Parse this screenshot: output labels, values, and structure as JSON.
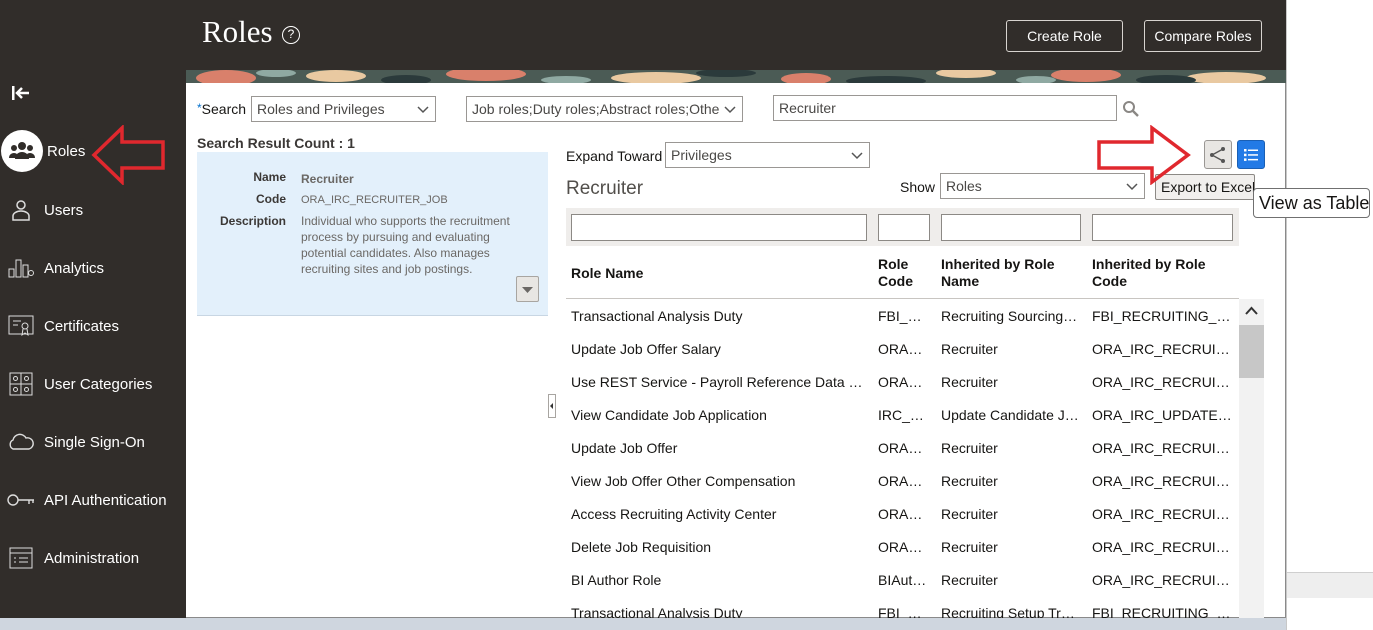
{
  "header": {
    "title": "Roles",
    "create_role": "Create Role",
    "compare_roles": "Compare Roles"
  },
  "sidebar": {
    "items": [
      {
        "label": "Roles",
        "icon": "roles-icon",
        "active": true
      },
      {
        "label": "Users",
        "icon": "user-icon"
      },
      {
        "label": "Analytics",
        "icon": "analytics-icon"
      },
      {
        "label": "Certificates",
        "icon": "certificate-icon"
      },
      {
        "label": "User Categories",
        "icon": "user-categories-icon"
      },
      {
        "label": "Single Sign-On",
        "icon": "cloud-icon"
      },
      {
        "label": "API Authentication",
        "icon": "key-icon"
      },
      {
        "label": "Administration",
        "icon": "administration-icon"
      }
    ]
  },
  "search": {
    "required_mark": "*",
    "label": "Search",
    "type_value": "Roles and Privileges",
    "role_types_value": "Job roles;Duty roles;Abstract roles;Othe",
    "query_value": "Recruiter"
  },
  "results": {
    "count_label": "Search Result Count : 1",
    "name_label": "Name",
    "name_value": "Recruiter",
    "code_label": "Code",
    "code_value": "ORA_IRC_RECRUITER_JOB",
    "description_label": "Description",
    "description_value": "Individual who supports the recruitment process by pursuing and evaluating potential candidates. Also manages recruiting sites and job postings."
  },
  "detail": {
    "expand_label": "Expand Toward",
    "expand_value": "Privileges",
    "role_heading": "Recruiter",
    "show_label": "Show",
    "show_value": "Roles",
    "export_label": "Export to Excel",
    "tooltip": "View as Table"
  },
  "table": {
    "columns": [
      "Role Name",
      "Role Code",
      "Inherited by Role Name",
      "Inherited by Role Code"
    ],
    "rows": [
      [
        "Transactional Analysis Duty",
        "FBI_T…",
        "Recruiting Sourcing…",
        "FBI_RECRUITING_…"
      ],
      [
        "Update Job Offer Salary",
        "ORA_…",
        "Recruiter",
        "ORA_IRC_RECRUI…"
      ],
      [
        "Use REST Service - Payroll Reference Data …",
        "ORA_…",
        "Recruiter",
        "ORA_IRC_RECRUI…"
      ],
      [
        "View Candidate Job Application",
        "IRC_…",
        "Update Candidate J…",
        "ORA_IRC_UPDATE…"
      ],
      [
        "Update Job Offer",
        "ORA_…",
        "Recruiter",
        "ORA_IRC_RECRUI…"
      ],
      [
        "View Job Offer Other Compensation",
        "ORA_…",
        "Recruiter",
        "ORA_IRC_RECRUI…"
      ],
      [
        "Access Recruiting Activity Center",
        "ORA_…",
        "Recruiter",
        "ORA_IRC_RECRUI…"
      ],
      [
        "Delete Job Requisition",
        "ORA_…",
        "Recruiter",
        "ORA_IRC_RECRUI…"
      ],
      [
        "BI Author Role",
        "BIAut…",
        "Recruiter",
        "ORA_IRC_RECRUI…"
      ],
      [
        "Transactional Analysis Duty",
        "FBI_T…",
        "Recruiting Setup Tr…",
        "FBI_RECRUITING_…"
      ]
    ]
  },
  "colors": {
    "sidebar_bg": "#312d2a",
    "accent_blue": "#227ae6",
    "annotation_red": "#e0282e",
    "selected_card_bg": "#e3f0fb"
  }
}
